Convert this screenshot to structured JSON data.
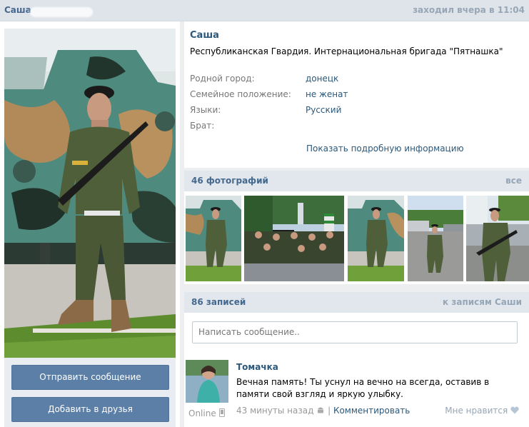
{
  "topbar": {
    "name": "Саша",
    "last_seen": "заходил вчера в 11:04"
  },
  "profile": {
    "name": "Саша",
    "status": "Республиканская Гвардия. Интернациональная бригада \"Пятнашка\"",
    "fields": [
      {
        "key": "Родной город:",
        "value": "донецк"
      },
      {
        "key": "Семейное положение:",
        "value": "не женат"
      },
      {
        "key": "Языки:",
        "value": "Русский"
      },
      {
        "key": "Брат:",
        "value": ""
      }
    ],
    "show_more": "Показать подробную информацию"
  },
  "actions": {
    "send_message": "Отправить сообщение",
    "add_friend": "Добавить в друзья"
  },
  "photos": {
    "title": "46 фотографий",
    "all_link": "все"
  },
  "wall": {
    "title": "86 записей",
    "link": "к записям Саши",
    "placeholder": "Написать сообщение.."
  },
  "post": {
    "author": "Томачка",
    "text": "Вечная память! Ты уснул на вечно на всегда, оставив в памяти свой взгляд и яркую улыбку.",
    "online": "Online",
    "time": "43 минуты назад",
    "separator": "|",
    "comment": "Комментировать",
    "like": "Мне нравится"
  },
  "colors": {
    "link": "#2b587a",
    "header_link": "#45688e",
    "button": "#5b7fa6",
    "background": "#edeef0"
  }
}
